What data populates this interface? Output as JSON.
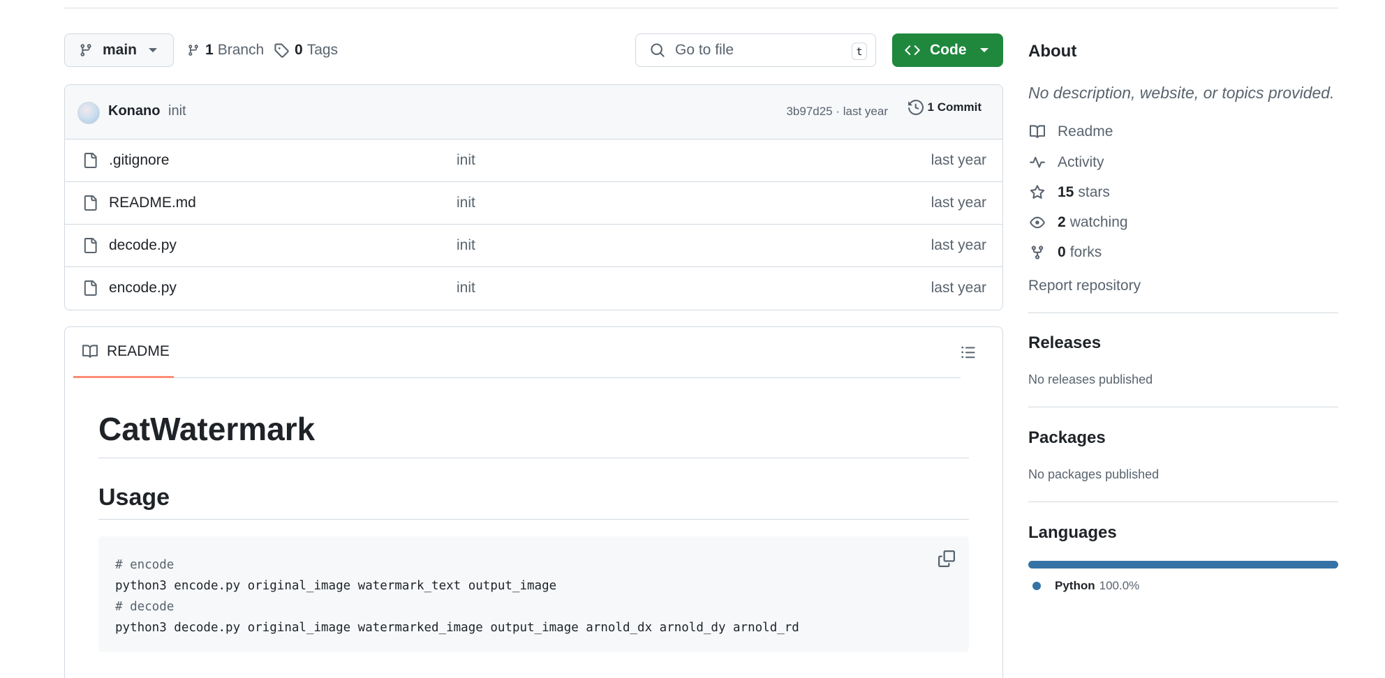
{
  "toolbar": {
    "branch": "main",
    "branch_count": "1",
    "branch_label": "Branch",
    "tag_count": "0",
    "tag_label": "Tags",
    "search_placeholder": "Go to file",
    "search_shortcut": "t",
    "code_label": "Code"
  },
  "latest_commit": {
    "author": "Konano",
    "message": "init",
    "hash_time": "3b97d25 · last year",
    "commit_count_label": "1 Commit"
  },
  "files": [
    {
      "name": ".gitignore",
      "message": "init",
      "date": "last year"
    },
    {
      "name": "README.md",
      "message": "init",
      "date": "last year"
    },
    {
      "name": "decode.py",
      "message": "init",
      "date": "last year"
    },
    {
      "name": "encode.py",
      "message": "init",
      "date": "last year"
    }
  ],
  "readme": {
    "tab_label": "README",
    "title": "CatWatermark",
    "usage_heading": "Usage",
    "code_lines": [
      "# encode",
      "python3 encode.py original_image watermark_text output_image",
      "# decode",
      "python3 decode.py original_image watermarked_image output_image arnold_dx arnold_dy arnold_rd"
    ]
  },
  "about": {
    "title": "About",
    "description": "No description, website, or topics provided.",
    "readme_label": "Readme",
    "activity_label": "Activity",
    "stars_count": "15",
    "stars_label": "stars",
    "watching_count": "2",
    "watching_label": "watching",
    "forks_count": "0",
    "forks_label": "forks",
    "report_label": "Report repository"
  },
  "releases": {
    "title": "Releases",
    "note": "No releases published"
  },
  "packages": {
    "title": "Packages",
    "note": "No packages published"
  },
  "languages": {
    "title": "Languages",
    "items": [
      {
        "name": "Python",
        "percent": "100.0%",
        "color": "#3572a5"
      }
    ]
  },
  "colors": {
    "primary_button": "#1f883d",
    "tab_underline": "#fd8c73",
    "python": "#3572a5"
  }
}
